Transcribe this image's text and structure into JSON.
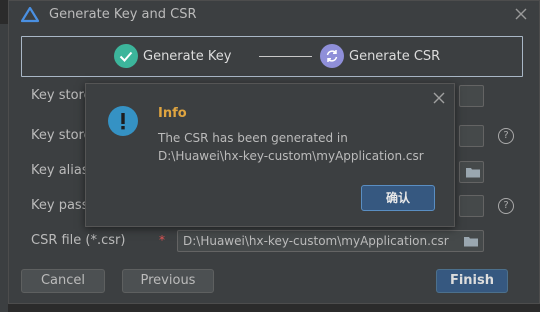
{
  "window": {
    "title": "Generate Key and CSR"
  },
  "steps": [
    {
      "label": "Generate Key",
      "state": "done",
      "color": "#3cb59b"
    },
    {
      "label": "Generate CSR",
      "state": "current",
      "color": "#8f8fd9"
    }
  ],
  "form": {
    "key_store": {
      "label": "Key store",
      "value": ""
    },
    "key_store_password": {
      "label": "Key store",
      "value": ""
    },
    "key_alias": {
      "label": "Key alias",
      "value": ""
    },
    "key_password": {
      "label": "Key passw",
      "value": ""
    },
    "csr_file": {
      "label": "CSR file (*.csr)",
      "required_mark": "*",
      "value": "D:\\Huawei\\hx-key-custom\\myApplication.csr"
    },
    "help_glyph": "?"
  },
  "buttons": {
    "cancel": "Cancel",
    "previous": "Previous",
    "finish": "Finish"
  },
  "dialog": {
    "title": "Info",
    "message_line1": "The CSR has been generated in",
    "message_line2": "D:\\Huawei\\hx-key-custom\\myApplication.csr",
    "ok_label": "确认"
  },
  "colors": {
    "accent_blue": "#365880",
    "info_icon": "#3592c4",
    "title_orange": "#e0a540",
    "required_red": "#e05555"
  }
}
